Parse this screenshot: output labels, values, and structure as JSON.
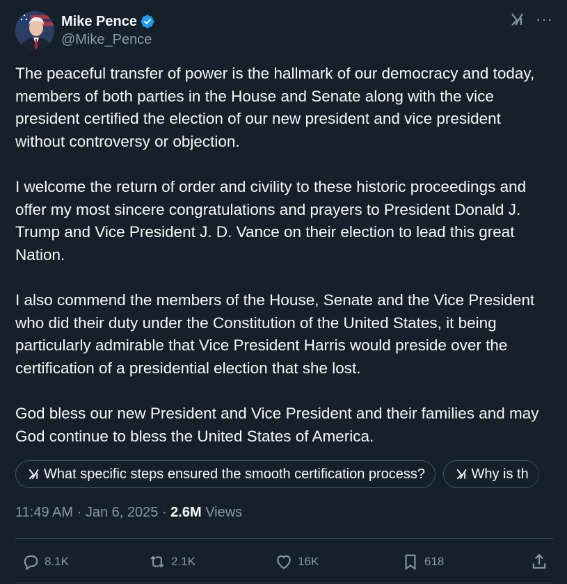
{
  "author": {
    "name": "Mike Pence",
    "handle": "@Mike_Pence",
    "verified": true
  },
  "icons": {
    "verified": "verified-badge-icon",
    "grok": "grok-icon",
    "more": "more-icon",
    "reply": "reply-icon",
    "retweet": "retweet-icon",
    "like": "heart-icon",
    "bookmark": "bookmark-icon",
    "share": "share-icon"
  },
  "tweet": {
    "paragraphs": [
      "The peaceful transfer of power is the hallmark of our democracy and today, members of both parties in the House and Senate along with the vice president certified the election of our new president and vice president without controversy or objection.",
      "I welcome the return of order and civility to these historic proceedings and offer my most sincere congratulations and prayers to President Donald J. Trump and Vice President J. D. Vance on their election to lead this great Nation.",
      "I also commend the members of the House, Senate and the Vice President who did their duty under the Constitution of the United States, it being particularly admirable that Vice President Harris would preside over the certification of a presidential election that she lost.",
      "God bless our new President and Vice President and their families and may God continue to bless the United States of America."
    ]
  },
  "grok_prompts": [
    "What specific steps ensured the smooth certification process?",
    "Why is th"
  ],
  "meta": {
    "time": "11:49 AM",
    "separator": "·",
    "date": "Jan 6, 2025",
    "views_count": "2.6M",
    "views_label": "Views"
  },
  "actions": {
    "replies": "8.1K",
    "reposts": "2.1K",
    "likes": "16K",
    "bookmarks": "618"
  },
  "colors": {
    "background": "#15202b",
    "text": "#f7f9f9",
    "muted": "#8b98a5",
    "border": "#38444d",
    "verified": "#1d9bf0"
  }
}
